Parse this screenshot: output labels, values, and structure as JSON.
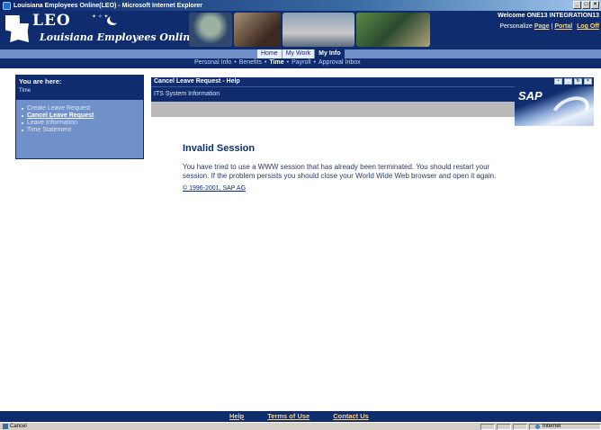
{
  "window": {
    "title": "Louisiana Employees Online(LEO) - Microsoft Internet Explorer",
    "buttons": [
      "_",
      "□",
      "×"
    ]
  },
  "header": {
    "logo_main": "LEO",
    "logo_sub": "Louisiana Employees Online",
    "welcome": "Welcome ONE13 INTEGRATION13",
    "personalize_label": "Personalize",
    "page_link": "Page",
    "portal_link": "Portal",
    "logoff_link": "Log Off"
  },
  "tabs": [
    {
      "label": "Home",
      "active": false
    },
    {
      "label": "My Work",
      "active": false
    },
    {
      "label": "My Info",
      "active": true
    }
  ],
  "subnav": [
    {
      "label": "Personal Info",
      "active": false
    },
    {
      "label": "Benefits",
      "active": false
    },
    {
      "label": "Time",
      "active": true
    },
    {
      "label": "Payroll",
      "active": false
    },
    {
      "label": "Approval Inbox",
      "active": false
    }
  ],
  "left_panel": {
    "title": "You are here:",
    "crumb": "Time",
    "items": [
      {
        "label": "Create Leave Request",
        "current": false
      },
      {
        "label": "Cancel Leave Request",
        "current": true
      },
      {
        "label": "Leave Information",
        "current": false
      },
      {
        "label": "Time Statement",
        "current": false
      }
    ]
  },
  "content": {
    "frame_title": "Cancel Leave Request - Help",
    "subtitle": "ITS System Information",
    "sap_logo": "SAP",
    "error_title": "Invalid Session",
    "error_text": "You have tried to use a WWW session that has already been terminated. You should restart your session. If the problem persists you should close your World Wide Web browser and open it again.",
    "copyright": "© 1996-2001, SAP AG"
  },
  "footer": {
    "links": [
      "Help",
      "Terms of Use",
      "Contact Us"
    ]
  },
  "statusbar": {
    "left_text": "Cancel",
    "zone": "Internet"
  },
  "colors": {
    "navy": "#0f2d6e",
    "panel_blue": "#6f90c8",
    "link_gold": "#ffd47a"
  }
}
